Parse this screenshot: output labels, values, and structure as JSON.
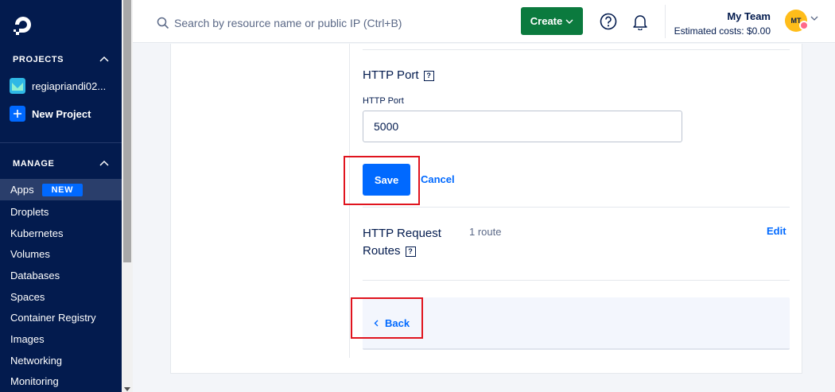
{
  "sidebar": {
    "projects_header": "PROJECTS",
    "project_name": "regiapriandi02...",
    "new_project": "New Project",
    "manage_header": "MANAGE",
    "nav": [
      {
        "label": "Apps",
        "badge": "NEW",
        "active": true
      },
      {
        "label": "Droplets"
      },
      {
        "label": "Kubernetes"
      },
      {
        "label": "Volumes"
      },
      {
        "label": "Databases"
      },
      {
        "label": "Spaces"
      },
      {
        "label": "Container Registry"
      },
      {
        "label": "Images"
      },
      {
        "label": "Networking"
      },
      {
        "label": "Monitoring"
      }
    ]
  },
  "topbar": {
    "search_placeholder": "Search by resource name or public IP (Ctrl+B)",
    "create_label": "Create",
    "team_name": "My Team",
    "estimated_costs": "Estimated costs: $0.00",
    "avatar_initials": "MT"
  },
  "main": {
    "http_port_title": "HTTP Port",
    "http_port_label": "HTTP Port",
    "http_port_value": "5000",
    "save_label": "Save",
    "cancel_label": "Cancel",
    "routes_title_line1": "HTTP Request",
    "routes_title_line2": "Routes",
    "routes_count": "1 route",
    "edit_label": "Edit",
    "back_label": "Back",
    "help_glyph": "?"
  },
  "colors": {
    "sidebar_bg": "#031b4e",
    "primary": "#0069ff",
    "create_green": "#0b7a3e",
    "annotation_red": "#e0141e"
  }
}
